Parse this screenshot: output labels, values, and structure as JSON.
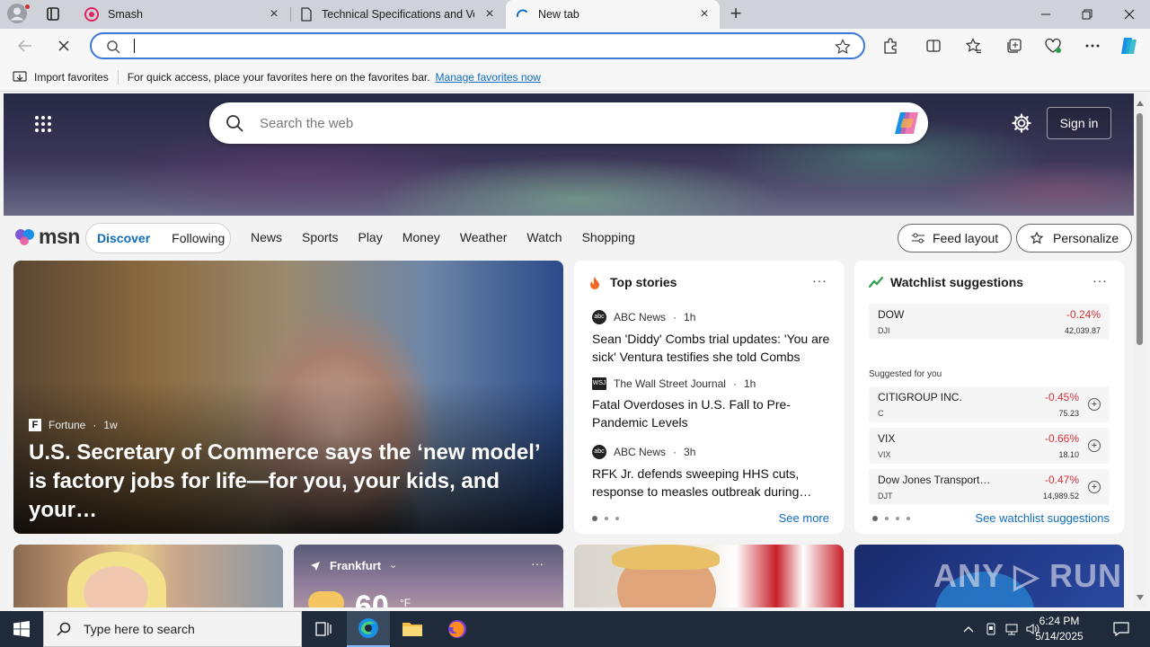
{
  "browser": {
    "tabs": [
      {
        "label": "Smash",
        "icon": "smash-icon"
      },
      {
        "label": "Technical Specifications and Ven",
        "icon": "document-icon"
      },
      {
        "label": "New tab",
        "icon": "loading-icon"
      }
    ],
    "address": {
      "value": ""
    },
    "favorites_bar": {
      "import_label": "Import favorites",
      "hint": "For quick access, place your favorites here on the favorites bar.",
      "manage_link": "Manage favorites now"
    }
  },
  "hero": {
    "search_placeholder": "Search the web",
    "sign_in": "Sign in"
  },
  "msn": {
    "logo": "msn",
    "feed_tabs": [
      "Discover",
      "Following"
    ],
    "nav": [
      "News",
      "Sports",
      "Play",
      "Money",
      "Weather",
      "Watch",
      "Shopping"
    ],
    "feed_layout": "Feed layout",
    "personalize": "Personalize"
  },
  "big_story": {
    "source": "Fortune",
    "age": "1w",
    "headline": "U.S. Secretary of Commerce says the ‘new model’ is factory jobs for life—for you, your kids, and your…"
  },
  "top_stories": {
    "title": "Top stories",
    "items": [
      {
        "source": "ABC News",
        "age": "1h",
        "headline": "Sean 'Diddy' Combs trial updates: 'You are sick' Ventura testifies she told Combs"
      },
      {
        "source": "The Wall Street Journal",
        "age": "1h",
        "headline": "Fatal Overdoses in U.S. Fall to Pre-Pandemic Levels"
      },
      {
        "source": "ABC News",
        "age": "3h",
        "headline": "RFK Jr. defends sweeping HHS cuts, response to measles outbreak during…"
      }
    ],
    "see_more": "See more"
  },
  "watchlist": {
    "title": "Watchlist suggestions",
    "main": {
      "name": "DOW",
      "symbol": "DJI",
      "change": "-0.24%",
      "price": "42,039.87"
    },
    "suggested_label": "Suggested for you",
    "suggested": [
      {
        "name": "CITIGROUP INC.",
        "symbol": "C",
        "change": "-0.45%",
        "price": "75.23"
      },
      {
        "name": "VIX",
        "symbol": "VIX",
        "change": "-0.66%",
        "price": "18.10"
      },
      {
        "name": "Dow Jones Transport…",
        "symbol": "DJT",
        "change": "-0.47%",
        "price": "14,989.52"
      }
    ],
    "see_link": "See watchlist suggestions"
  },
  "weather_card": {
    "location": "Frankfurt",
    "temp": "60",
    "unit": "°F"
  },
  "taskbar": {
    "search_placeholder": "Type here to search",
    "time": "6:24 PM",
    "date": "5/14/2025"
  },
  "colors": {
    "accent": "#0f6cbd",
    "negative": "#d13438",
    "taskbar": "#1f2b3a"
  }
}
